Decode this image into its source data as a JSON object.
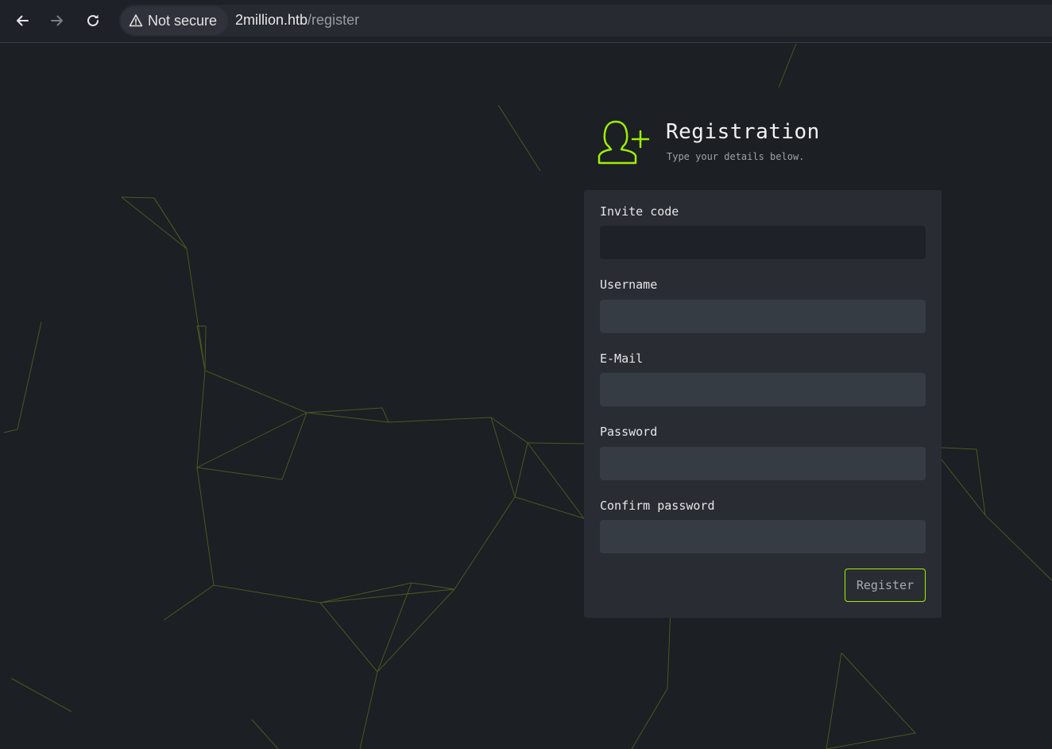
{
  "browser": {
    "back_icon": "arrow-left-icon",
    "forward_icon": "arrow-right-icon",
    "reload_icon": "reload-icon",
    "security_icon": "warning-triangle-icon",
    "security_text": "Not secure",
    "url_host": "2million.htb",
    "url_path": "/register"
  },
  "header": {
    "icon": "user-plus-icon",
    "title": "Registration",
    "subtitle": "Type your details below."
  },
  "form": {
    "fields": [
      {
        "label": "Invite code",
        "value": "",
        "placeholder": ""
      },
      {
        "label": "Username",
        "value": "",
        "placeholder": ""
      },
      {
        "label": "E-Mail",
        "value": "",
        "placeholder": ""
      },
      {
        "label": "Password",
        "value": "",
        "placeholder": ""
      },
      {
        "label": "Confirm password",
        "value": "",
        "placeholder": ""
      }
    ],
    "submit_label": "Register"
  },
  "colors": {
    "accent": "#9fef00",
    "background": "#1c1f24",
    "card": "#292d33",
    "input": "#363c44"
  }
}
